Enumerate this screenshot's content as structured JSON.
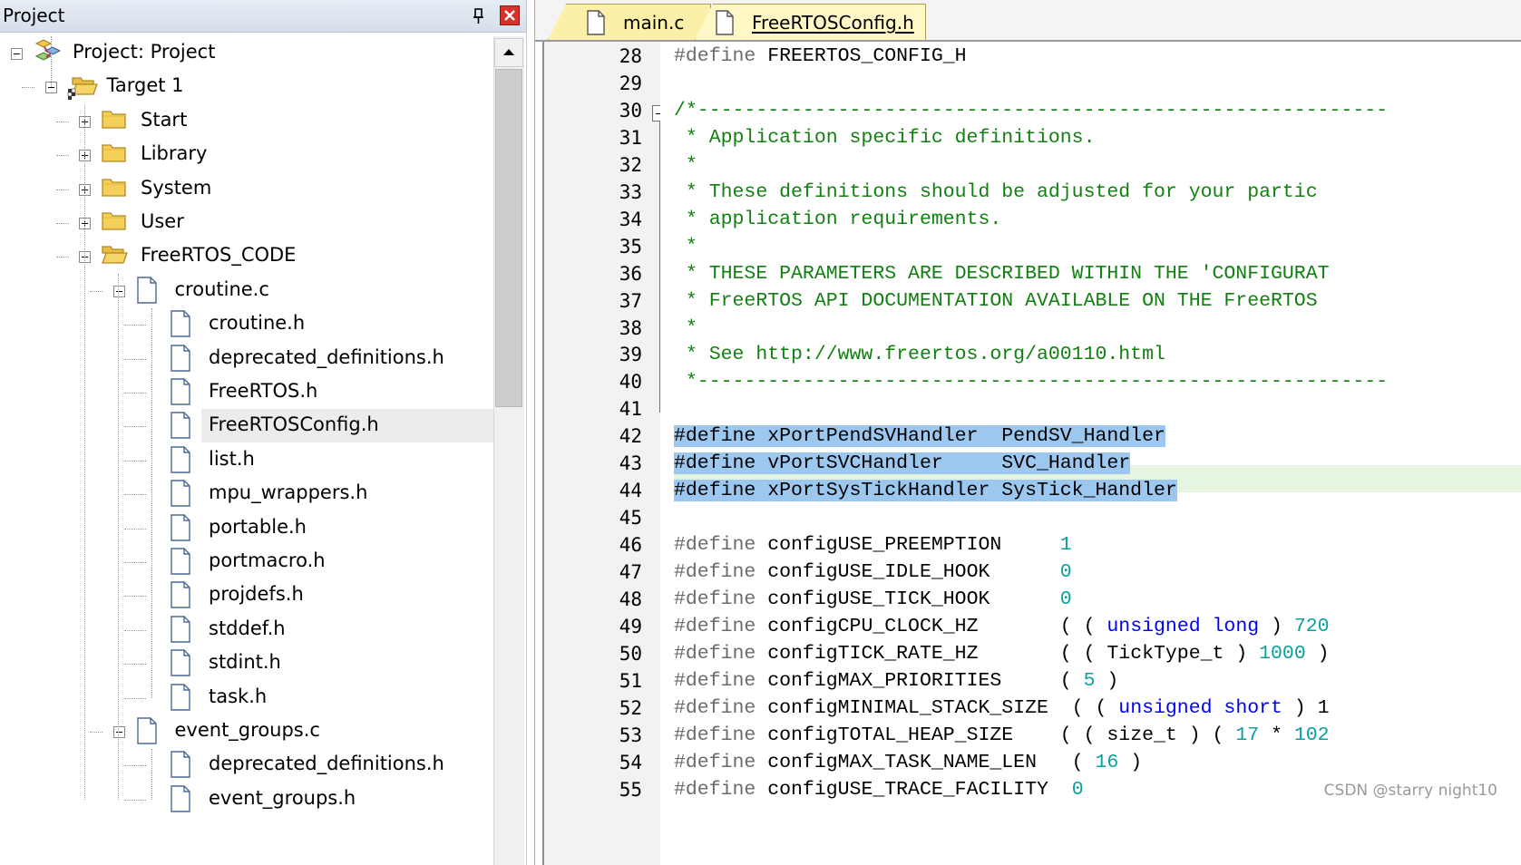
{
  "project_panel": {
    "title": "Project",
    "tree": [
      {
        "label": "Project: Project",
        "icon": "project-icon",
        "expander": "minus"
      },
      {
        "label": "Target 1",
        "icon": "target-folder-icon",
        "expander": "minus"
      },
      {
        "label": "Start",
        "icon": "folder-icon",
        "expander": "plus"
      },
      {
        "label": "Library",
        "icon": "folder-icon",
        "expander": "plus"
      },
      {
        "label": "System",
        "icon": "folder-icon",
        "expander": "plus"
      },
      {
        "label": "User",
        "icon": "folder-icon",
        "expander": "plus"
      },
      {
        "label": "FreeRTOS_CODE",
        "icon": "open-folder-icon",
        "expander": "minus"
      },
      {
        "label": "croutine.c",
        "icon": "file-icon",
        "expander": "minus"
      },
      {
        "label": "croutine.h",
        "icon": "file-icon"
      },
      {
        "label": "deprecated_definitions.h",
        "icon": "file-icon"
      },
      {
        "label": "FreeRTOS.h",
        "icon": "file-icon"
      },
      {
        "label": "FreeRTOSConfig.h",
        "icon": "file-icon",
        "selected": true
      },
      {
        "label": "list.h",
        "icon": "file-icon"
      },
      {
        "label": "mpu_wrappers.h",
        "icon": "file-icon"
      },
      {
        "label": "portable.h",
        "icon": "file-icon"
      },
      {
        "label": "portmacro.h",
        "icon": "file-icon"
      },
      {
        "label": "projdefs.h",
        "icon": "file-icon"
      },
      {
        "label": "stddef.h",
        "icon": "file-icon"
      },
      {
        "label": "stdint.h",
        "icon": "file-icon"
      },
      {
        "label": "task.h",
        "icon": "file-icon"
      },
      {
        "label": "event_groups.c",
        "icon": "file-icon",
        "expander": "minus"
      },
      {
        "label": "deprecated_definitions.h",
        "icon": "file-icon"
      },
      {
        "label": "event_groups.h",
        "icon": "file-icon"
      }
    ]
  },
  "editor": {
    "tabs": [
      {
        "label": "main.c",
        "active": false
      },
      {
        "label": "FreeRTOSConfig.h",
        "active": true
      }
    ],
    "lines": [
      {
        "n": "28",
        "parts": [
          [
            "kw",
            "#define"
          ],
          [
            "t",
            " FREERTOS_CONFIG_H"
          ]
        ]
      },
      {
        "n": "29",
        "parts": []
      },
      {
        "n": "30",
        "parts": [
          [
            "c",
            "/*-----------------------------------------------------------"
          ]
        ]
      },
      {
        "n": "31",
        "parts": [
          [
            "c",
            " * Application specific definitions."
          ]
        ]
      },
      {
        "n": "32",
        "parts": [
          [
            "c",
            " *"
          ]
        ]
      },
      {
        "n": "33",
        "parts": [
          [
            "c",
            " * These definitions should be adjusted for your partic"
          ]
        ]
      },
      {
        "n": "34",
        "parts": [
          [
            "c",
            " * application requirements."
          ]
        ]
      },
      {
        "n": "35",
        "parts": [
          [
            "c",
            " *"
          ]
        ]
      },
      {
        "n": "36",
        "parts": [
          [
            "c",
            " * THESE PARAMETERS ARE DESCRIBED WITHIN THE 'CONFIGURAT"
          ]
        ]
      },
      {
        "n": "37",
        "parts": [
          [
            "c",
            " * FreeRTOS API DOCUMENTATION AVAILABLE ON THE FreeRTOS"
          ]
        ]
      },
      {
        "n": "38",
        "parts": [
          [
            "c",
            " *"
          ]
        ]
      },
      {
        "n": "39",
        "parts": [
          [
            "c",
            " * See http://www.freertos.org/a00110.html"
          ]
        ]
      },
      {
        "n": "40",
        "parts": [
          [
            "c",
            " *-----------------------------------------------------------"
          ]
        ]
      },
      {
        "n": "41",
        "parts": []
      },
      {
        "n": "42",
        "parts": [
          [
            "h",
            "#define xPortPendSVHandler  PendSV_Handler"
          ]
        ]
      },
      {
        "n": "43",
        "parts": [
          [
            "h",
            "#define vPortSVCHandler     SVC_Handler"
          ]
        ]
      },
      {
        "n": "44",
        "parts": [
          [
            "h",
            "#define xPortSysTickHandler SysTick_Handler"
          ]
        ]
      },
      {
        "n": "45",
        "parts": []
      },
      {
        "n": "46",
        "parts": [
          [
            "kw",
            "#define"
          ],
          [
            "t",
            " configUSE_PREEMPTION     "
          ],
          [
            "num",
            "1"
          ]
        ]
      },
      {
        "n": "47",
        "parts": [
          [
            "kw",
            "#define"
          ],
          [
            "t",
            " configUSE_IDLE_HOOK      "
          ],
          [
            "num",
            "0"
          ]
        ]
      },
      {
        "n": "48",
        "parts": [
          [
            "kw",
            "#define"
          ],
          [
            "t",
            " configUSE_TICK_HOOK      "
          ],
          [
            "num",
            "0"
          ]
        ]
      },
      {
        "n": "49",
        "parts": [
          [
            "kw",
            "#define"
          ],
          [
            "t",
            " configCPU_CLOCK_HZ       ( ( "
          ],
          [
            "ty",
            "unsigned long"
          ],
          [
            "t",
            " ) "
          ],
          [
            "num",
            "720"
          ]
        ]
      },
      {
        "n": "50",
        "parts": [
          [
            "kw",
            "#define"
          ],
          [
            "t",
            " configTICK_RATE_HZ       ( ( TickType_t ) "
          ],
          [
            "num",
            "1000"
          ],
          [
            "t",
            " )"
          ]
        ]
      },
      {
        "n": "51",
        "parts": [
          [
            "kw",
            "#define"
          ],
          [
            "t",
            " configMAX_PRIORITIES     ( "
          ],
          [
            "num",
            "5"
          ],
          [
            "t",
            " )"
          ]
        ]
      },
      {
        "n": "52",
        "parts": [
          [
            "kw",
            "#define"
          ],
          [
            "t",
            " configMINIMAL_STACK_SIZE  ( ( "
          ],
          [
            "ty",
            "unsigned short"
          ],
          [
            "t",
            " ) 1"
          ]
        ]
      },
      {
        "n": "53",
        "parts": [
          [
            "kw",
            "#define"
          ],
          [
            "t",
            " configTOTAL_HEAP_SIZE    ( ( size_t ) ( "
          ],
          [
            "num",
            "17"
          ],
          [
            "t",
            " * "
          ],
          [
            "num",
            "102"
          ]
        ]
      },
      {
        "n": "54",
        "parts": [
          [
            "kw",
            "#define"
          ],
          [
            "t",
            " configMAX_TASK_NAME_LEN   ( "
          ],
          [
            "num",
            "16"
          ],
          [
            "t",
            " )"
          ]
        ]
      },
      {
        "n": "55",
        "parts": [
          [
            "kw",
            "#define"
          ],
          [
            "t",
            " configUSE_TRACE_FACILITY  "
          ],
          [
            "num",
            "0"
          ]
        ]
      }
    ]
  },
  "watermark": "CSDN @starry night10"
}
